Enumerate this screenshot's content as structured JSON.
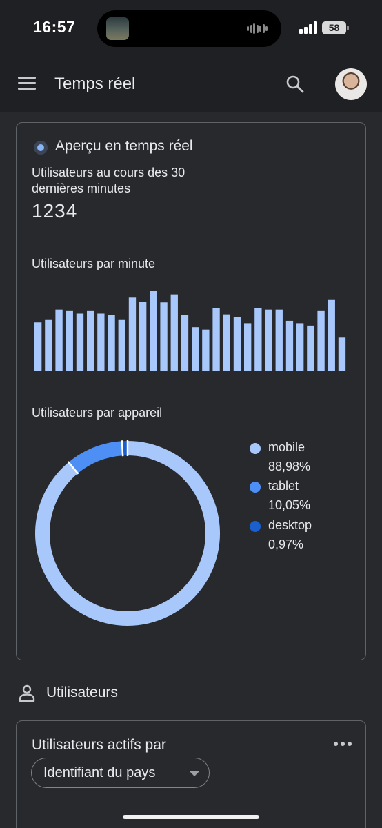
{
  "status_bar": {
    "time": "16:57",
    "battery": "58"
  },
  "app_bar": {
    "title": "Temps réel"
  },
  "realtime_card": {
    "title": "Aperçu en temps réel",
    "users_label": "Utilisateurs au cours des 30 dernières minutes",
    "users_count": "1234",
    "per_minute_label": "Utilisateurs par minute",
    "per_device_label": "Utilisateurs par appareil"
  },
  "legend": [
    {
      "name": "mobile",
      "pct": "88,98%",
      "color": "#a8c7fa"
    },
    {
      "name": "tablet",
      "pct": "10,05%",
      "color": "#4d8ff5"
    },
    {
      "name": "desktop",
      "pct": "0,97%",
      "color": "#1a5fcc"
    }
  ],
  "chart_data": [
    {
      "type": "bar",
      "title": "Utilisateurs par minute",
      "values": [
        61,
        64,
        77,
        76,
        72,
        76,
        72,
        70,
        64,
        92,
        87,
        100,
        86,
        96,
        70,
        55,
        52,
        79,
        71,
        68,
        60,
        79,
        77,
        77,
        63,
        60,
        57,
        76,
        89,
        42
      ],
      "color": "#a8c7fa"
    },
    {
      "type": "pie",
      "title": "Utilisateurs par appareil",
      "labels": [
        "mobile",
        "tablet",
        "desktop"
      ],
      "values": [
        88.98,
        10.05,
        0.97
      ],
      "colors": [
        "#a8c7fa",
        "#4d8ff5",
        "#1a5fcc"
      ]
    }
  ],
  "users_section": {
    "title": "Utilisateurs"
  },
  "active_users_card": {
    "title": "Utilisateurs actifs par",
    "dropdown_value": "Identifiant du pays"
  }
}
